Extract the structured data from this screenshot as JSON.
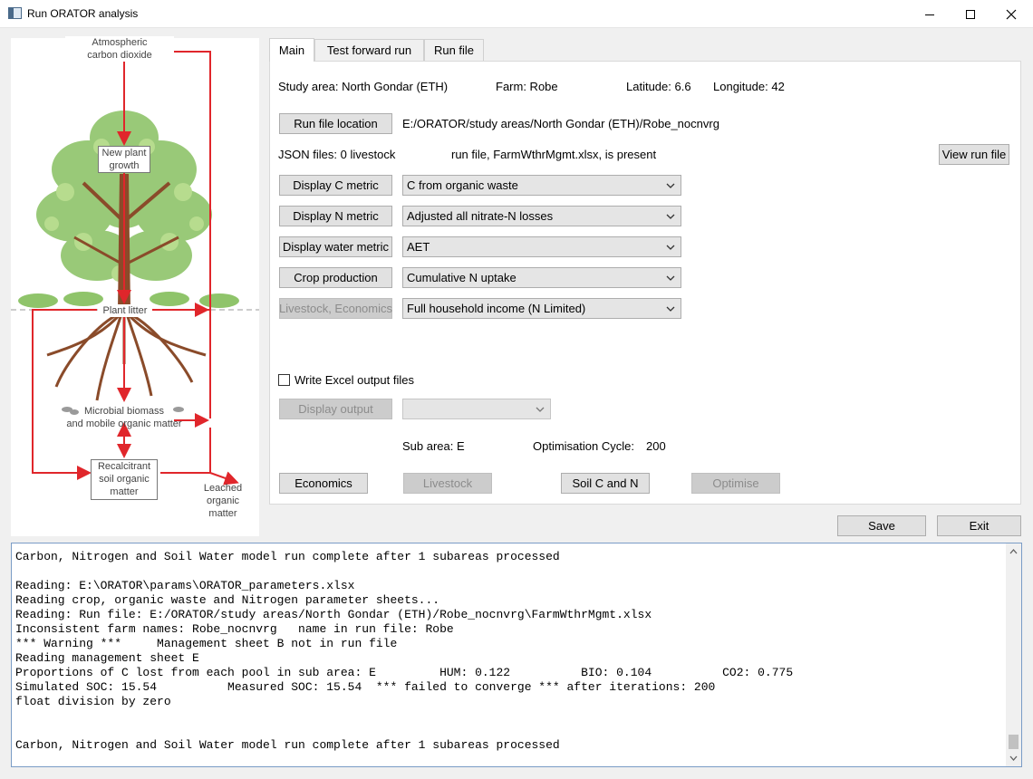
{
  "window": {
    "title": "Run ORATOR analysis"
  },
  "diagram": {
    "atmos": [
      "Atmospheric",
      "carbon dioxide"
    ],
    "growth": [
      "New plant",
      "growth"
    ],
    "litter": "Plant litter",
    "microbial": [
      "Microbial biomass",
      "and mobile organic matter"
    ],
    "recalcitrant": [
      "Recalcitrant",
      "soil organic",
      "matter"
    ],
    "leached": [
      "Leached",
      "organic",
      "matter"
    ],
    "arrow_color": "#e0262b"
  },
  "tabs": [
    "Main",
    "Test forward run",
    "Run file"
  ],
  "main": {
    "study_area": "Study area: North Gondar (ETH)",
    "farm": "Farm: Robe",
    "latitude": "Latitude: 6.6",
    "longitude": "Longitude: 42",
    "run_file_location_label": "Run file location",
    "run_file_path": "E:/ORATOR/study areas/North Gondar (ETH)/Robe_nocnvrg",
    "json_files": "JSON files:  0 livestock",
    "run_file_status": "run file, FarmWthrMgmt.xlsx, is present",
    "view_run_file_label": "View run file",
    "metric_rows": [
      {
        "button": "Display C metric",
        "value": "C from organic waste",
        "disabled": false
      },
      {
        "button": "Display N metric",
        "value": "Adjusted all nitrate-N losses",
        "disabled": false
      },
      {
        "button": "Display water metric",
        "value": "AET",
        "disabled": false
      },
      {
        "button": "Crop production",
        "value": "Cumulative N uptake",
        "disabled": false
      },
      {
        "button": "Livestock, Economics",
        "value": "Full household income (N Limited)",
        "disabled": true
      }
    ],
    "write_excel_label": "Write Excel output files",
    "display_output_label": "Display output",
    "display_output_value": "",
    "sub_area": "Sub area: E",
    "opt_cycle_label": "Optimisation Cycle:",
    "opt_cycle_value": "200",
    "economics_label": "Economics",
    "livestock_label": "Livestock",
    "soil_cn_label": "Soil C and N",
    "optimise_label": "Optimise"
  },
  "footer": {
    "save_label": "Save",
    "exit_label": "Exit"
  },
  "log": [
    "Carbon, Nitrogen and Soil Water model run complete after 1 subareas processed",
    "",
    "Reading: E:\\ORATOR\\params\\ORATOR_parameters.xlsx",
    "Reading crop, organic waste and Nitrogen parameter sheets...",
    "Reading: Run file: E:/ORATOR/study areas/North Gondar (ETH)/Robe_nocnvrg\\FarmWthrMgmt.xlsx",
    "Inconsistent farm names: Robe_nocnvrg   name in run file: Robe",
    "*** Warning ***     Management sheet B not in run file",
    "Reading management sheet E",
    "Proportions of C lost from each pool in sub area: E         HUM: 0.122          BIO: 0.104          CO2: 0.775",
    "Simulated SOC: 15.54          Measured SOC: 15.54  *** failed to converge *** after iterations: 200",
    "float division by zero",
    "",
    "",
    "Carbon, Nitrogen and Soil Water model run complete after 1 subareas processed"
  ]
}
